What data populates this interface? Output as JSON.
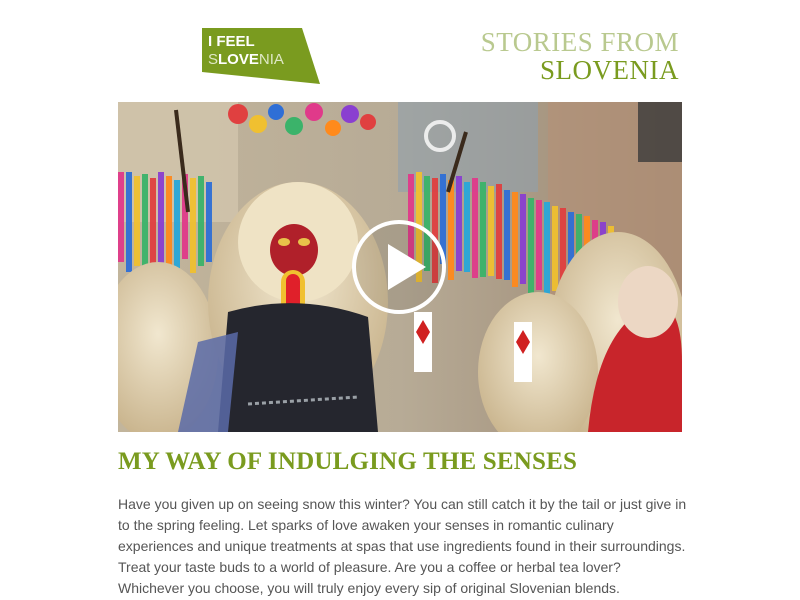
{
  "header": {
    "logo": {
      "line1": "I FEEL",
      "line2_part1": "S",
      "line2_part2": "LOVE",
      "line2_part3": "NIA",
      "color_bg": "#7a9b1f"
    },
    "title_line1": "STORIES FROM",
    "title_line2": "SLOVENIA"
  },
  "hero": {
    "type": "video",
    "control_icon": "play-icon"
  },
  "article": {
    "title": "MY WAY OF INDULGING THE SENSES",
    "body": "Have you given up on seeing snow this winter? You can still catch it by the tail or just give in to the spring feeling. Let sparks of love awaken your senses in romantic culinary experiences and unique treatments at spas that use ingredients found in their surroundings. Treat your taste buds to a world of pleasure. Are you a coffee or herbal tea lover? Whichever you choose, you will truly enjoy every sip of original Slovenian blends."
  },
  "colors": {
    "accent_green": "#7a9b1f",
    "light_green": "#b9c98f",
    "body_text": "#555555"
  }
}
